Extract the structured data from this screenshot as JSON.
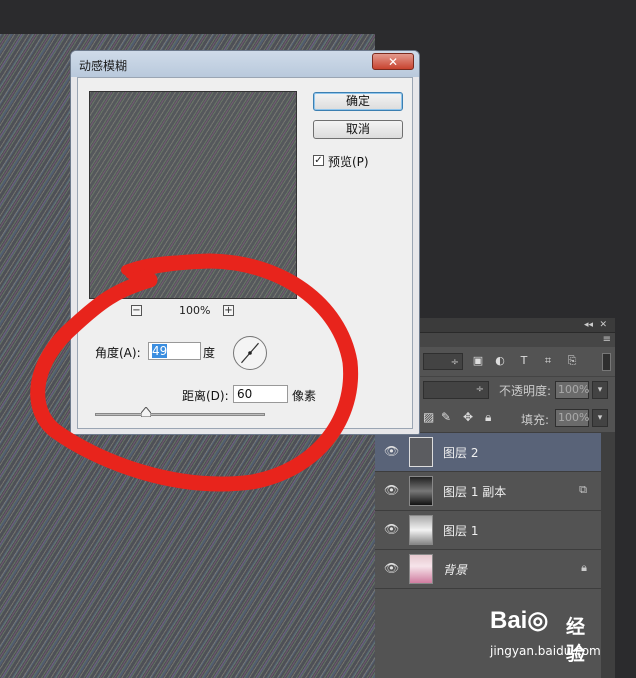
{
  "dialog": {
    "title": "动感模糊",
    "close_glyph": "✕",
    "ok_label": "确定",
    "cancel_label": "取消",
    "preview_label": "预览(P)",
    "preview_checked": "✓",
    "zoom_out": "−",
    "zoom_in": "+",
    "zoom_level": "100%",
    "angle_label": "角度(A):",
    "angle_value": "49",
    "angle_unit": "度",
    "distance_label": "距离(D):",
    "distance_value": "60",
    "distance_unit": "像素",
    "distance_slider_fraction": 0.3
  },
  "layers_panel": {
    "collapse_glyph": "◂◂",
    "close_glyph": "✕",
    "menu_glyph": "≡",
    "filter_dropdown": "÷",
    "opacity_label": "不透明度:",
    "opacity_value": "100%",
    "blend_dropdown": "÷",
    "fill_label": "填充:",
    "fill_value": "100%",
    "dropdown_glyph": "▾",
    "layers": [
      {
        "name": "图层 2",
        "selected": true
      },
      {
        "name": "图层 1 副本",
        "selected": false
      },
      {
        "name": "图层 1",
        "selected": false
      },
      {
        "name": "背景",
        "selected": false,
        "locked": true
      }
    ]
  },
  "watermark": {
    "logo": "Bai◎",
    "chinese": "经验",
    "url": "jingyan.baidu.com"
  },
  "colors": {
    "annotation_red": "#e8241c",
    "selected_layer": "#596378",
    "dialog_title": "#b9c9dc"
  }
}
